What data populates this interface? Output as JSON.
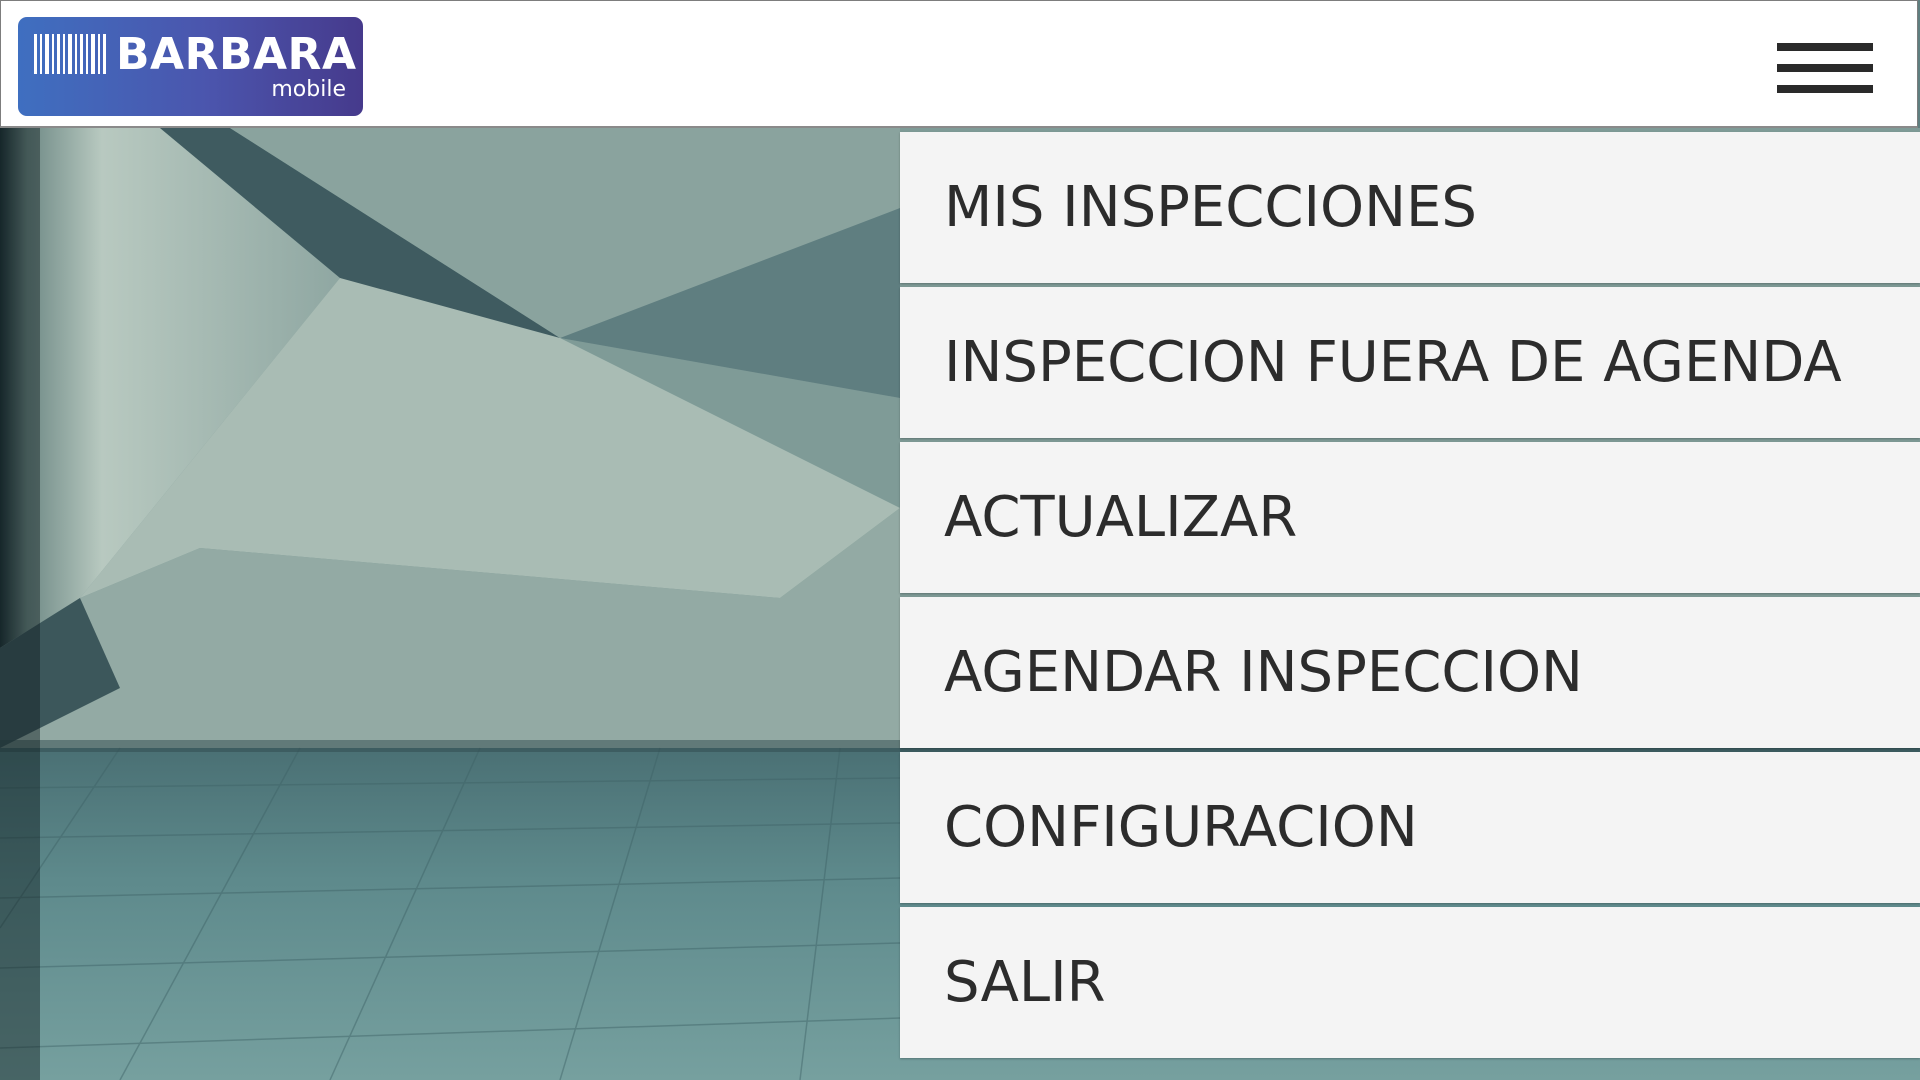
{
  "header": {
    "logo": {
      "title": "BARBARA",
      "subtitle": "mobile",
      "icon": "barcode-icon"
    },
    "menu_button_icon": "hamburger-icon"
  },
  "menu": {
    "items": [
      {
        "label": "MIS INSPECCIONES"
      },
      {
        "label": "INSPECCION FUERA DE AGENDA"
      },
      {
        "label": "ACTUALIZAR"
      },
      {
        "label": "AGENDAR INSPECCION"
      },
      {
        "label": "CONFIGURACION"
      },
      {
        "label": "SALIR"
      }
    ]
  },
  "colors": {
    "logo_gradient_start": "#3f6fc0",
    "logo_gradient_end": "#463a8c",
    "menu_background": "#f4f4f4",
    "menu_text": "#2c2c2c",
    "header_background": "#ffffff"
  }
}
